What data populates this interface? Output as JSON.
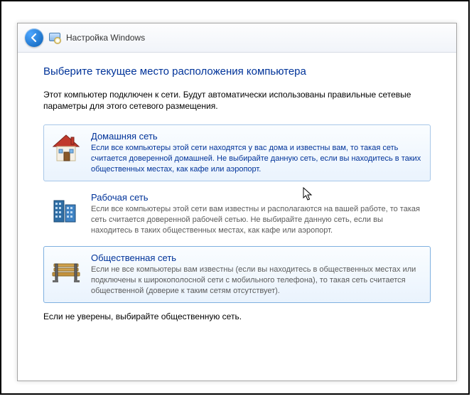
{
  "titlebar": {
    "back_label": "Назад",
    "app_title": "Настройка Windows"
  },
  "main": {
    "heading": "Выберите текущее место расположения компьютера",
    "intro": "Этот компьютер подключен к сети. Будут автоматически использованы правильные сетевые параметры для этого сетевого размещения."
  },
  "options": [
    {
      "id": "home",
      "title": "Домашняя сеть",
      "desc": "Если все компьютеры этой сети находятся у вас дома и известны вам, то такая сеть считается доверенной домашней. Не выбирайте данную сеть, если вы находитесь в таких общественных местах, как кафе или аэропорт.",
      "desc_color": "blue",
      "state": "hovered"
    },
    {
      "id": "work",
      "title": "Рабочая сеть",
      "desc": "Если все компьютеры этой сети вам известны и располагаются на вашей работе, то такая сеть считается доверенной рабочей сетью. Не выбирайте данную сеть, если вы находитесь в таких общественных местах, как кафе или аэропорт.",
      "desc_color": "gray",
      "state": "normal"
    },
    {
      "id": "public",
      "title": "Общественная сеть",
      "desc": "Если не все компьютеры вам известны (если вы находитесь в общественных местах или подключены к широкополосной сети с мобильного телефона), то такая сеть считается общественной (доверие к таким сетям отсутствует).",
      "desc_color": "gray",
      "state": "selected"
    }
  ],
  "footer": {
    "note": "Если не уверены, выбирайте общественную сеть."
  },
  "icons": {
    "back": "back-arrow-icon",
    "setup": "windows-setup-icon",
    "home": "house-icon",
    "work": "office-buildings-icon",
    "public": "park-bench-icon"
  }
}
